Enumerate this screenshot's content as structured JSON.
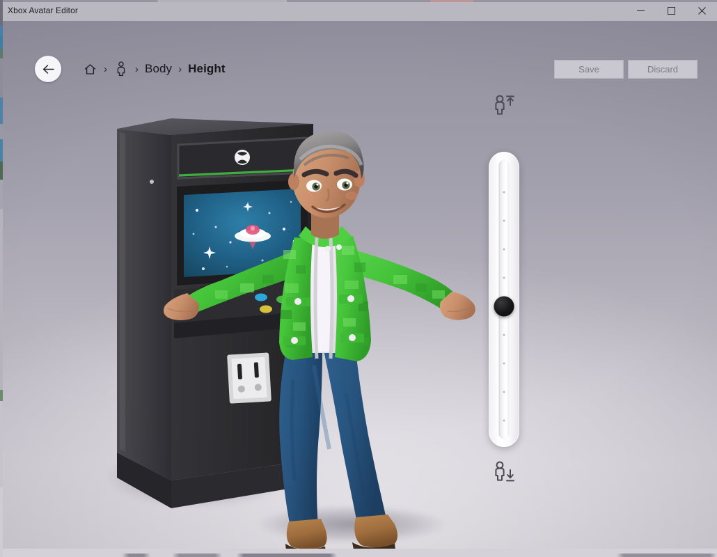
{
  "window": {
    "title": "Xbox Avatar Editor",
    "controls": [
      {
        "name": "minimize",
        "label": "–"
      },
      {
        "name": "maximize",
        "label": "□"
      },
      {
        "name": "close",
        "label": "✕"
      }
    ]
  },
  "topbar": {
    "back_label": "Back",
    "breadcrumb": [
      {
        "type": "icon",
        "icon": "home-icon",
        "label": "Home"
      },
      {
        "type": "icon",
        "icon": "avatar-person-icon",
        "label": "Avatar"
      },
      {
        "type": "text",
        "label": "Body",
        "active": false
      },
      {
        "type": "text",
        "label": "Height",
        "active": true
      }
    ],
    "separator": "›",
    "actions": [
      {
        "name": "save",
        "label": "Save",
        "enabled": false
      },
      {
        "name": "discard",
        "label": "Discard",
        "enabled": false
      }
    ]
  },
  "slider": {
    "name": "height-slider",
    "orientation": "vertical",
    "top_icon": "person-taller-icon",
    "bottom_icon": "person-shorter-icon",
    "top_icon_label": "Taller",
    "bottom_icon_label": "Shorter",
    "tick_count": 9,
    "thumb_position_percent": 48,
    "value": 6,
    "min": 1,
    "max": 11
  },
  "scene": {
    "avatar_description": "Xbox avatar leaning on an arcade cabinet",
    "cabinet_label": "Xbox arcade cabinet",
    "screen_scene": "UFO in starry space"
  },
  "colors": {
    "titlebar": "#b9b7c0",
    "scene_top": "#93919f",
    "scene_bottom": "#d2ced6",
    "accent_green": "#3fae3f",
    "jacket_green": "#45c43a",
    "jeans_blue": "#27547f",
    "boot_brown": "#a8733f",
    "skin": "#c98f6b",
    "hair_gray": "#8d8a8c",
    "slider_track": "#ffffff",
    "thumb": "#0d0d0f",
    "button_disabled_text": "#7d7b85"
  }
}
